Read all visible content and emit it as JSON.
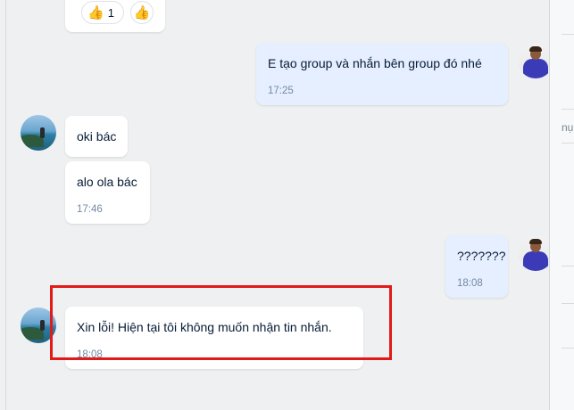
{
  "reactions": {
    "emoji": "👍",
    "count": "1",
    "add_emoji": "👍"
  },
  "messages": [
    {
      "text": "E tạo group và nhắn bên group đó nhé",
      "time": "17:25"
    },
    {
      "text": "oki bác"
    },
    {
      "text": "alo ola bác",
      "time": "17:46"
    },
    {
      "text": "???????",
      "time": "18:08"
    },
    {
      "text": "Xin lỗi! Hiện tại tôi không muốn nhận tin nhắn.",
      "time": "18:08"
    }
  ],
  "right_panel": {
    "fragment": "nụ"
  },
  "colors": {
    "highlight": "#e21a1a",
    "my_bubble": "#e5efff",
    "their_bubble": "#ffffff"
  },
  "icons": {
    "scenery_avatar": "avatar-scenery",
    "profile_avatar": "avatar-person"
  }
}
